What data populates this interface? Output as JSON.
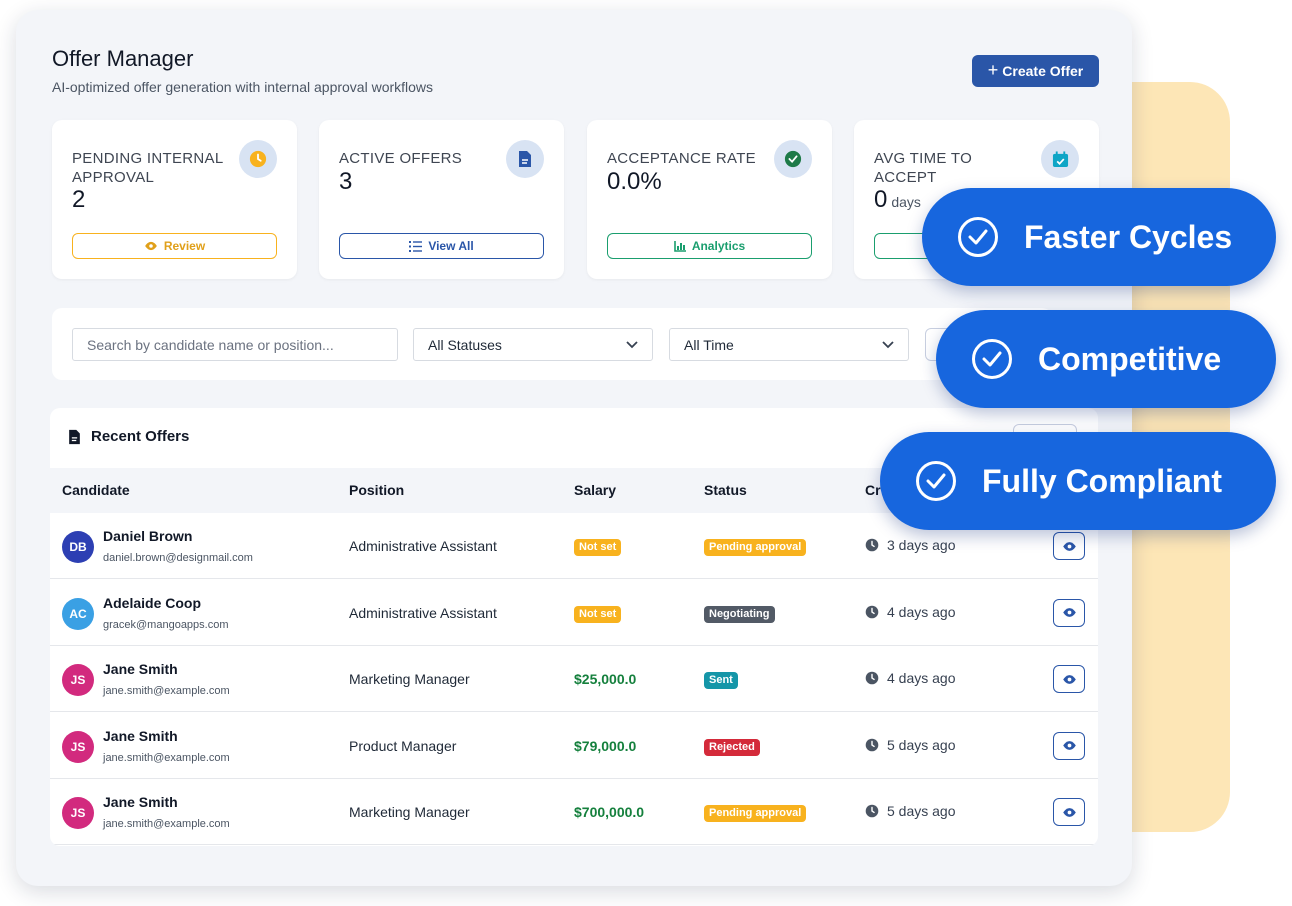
{
  "header": {
    "title": "Offer Manager",
    "subtitle": "AI-optimized offer generation with internal approval workflows",
    "create_label": "Create Offer"
  },
  "stats": [
    {
      "label": "PENDING INTERNAL APPROVAL",
      "value": "2",
      "unit": "",
      "button": "Review",
      "icon": "clock-icon",
      "color": "#f8b21e"
    },
    {
      "label": "ACTIVE OFFERS",
      "value": "3",
      "unit": "",
      "button": "View All",
      "icon": "document-icon",
      "color": "#2a56a8"
    },
    {
      "label": "ACCEPTANCE RATE",
      "value": "0.0%",
      "unit": "",
      "button": "Analytics",
      "icon": "check-circle-icon",
      "color": "#1a9e6e"
    },
    {
      "label": "AVG TIME TO ACCEPT",
      "value": "0",
      "unit": "days",
      "button": "",
      "icon": "calendar-check-icon",
      "color": "#0ea5c6"
    }
  ],
  "filters": {
    "search_placeholder": "Search by candidate name or position...",
    "status_selected": "All Statuses",
    "time_selected": "All Time"
  },
  "table": {
    "title": "Recent Offers",
    "columns": {
      "candidate": "Candidate",
      "position": "Position",
      "salary": "Salary",
      "status": "Status",
      "created": "Cr"
    },
    "rows": [
      {
        "initials": "DB",
        "avatar_color": "#2d3fb3",
        "name": "Daniel Brown",
        "email": "daniel.brown@designmail.com",
        "position": "Administrative Assistant",
        "salary": "Not set",
        "status": "Pending approval",
        "status_color": "#f8b21e",
        "created": "3 days ago"
      },
      {
        "initials": "AC",
        "avatar_color": "#3aa0e4",
        "name": "Adelaide Coop",
        "email": "gracek@mangoapps.com",
        "position": "Administrative Assistant",
        "salary": "Not set",
        "status": "Negotiating",
        "status_color": "#525a66",
        "created": "4 days ago"
      },
      {
        "initials": "JS",
        "avatar_color": "#d22a7e",
        "name": "Jane Smith",
        "email": "jane.smith@example.com",
        "position": "Marketing Manager",
        "salary": "$25,000.0",
        "status": "Sent",
        "status_color": "#1596a8",
        "created": "4 days ago"
      },
      {
        "initials": "JS",
        "avatar_color": "#d22a7e",
        "name": "Jane Smith",
        "email": "jane.smith@example.com",
        "position": "Product Manager",
        "salary": "$79,000.0",
        "status": "Rejected",
        "status_color": "#d42a3a",
        "created": "5 days ago"
      },
      {
        "initials": "JS",
        "avatar_color": "#d22a7e",
        "name": "Jane Smith",
        "email": "jane.smith@example.com",
        "position": "Marketing Manager",
        "salary": "$700,000.0",
        "status": "Pending approval",
        "status_color": "#f8b21e",
        "created": "5 days ago"
      }
    ]
  },
  "badges": [
    "Faster Cycles",
    "Competitive",
    "Fully Compliant"
  ]
}
